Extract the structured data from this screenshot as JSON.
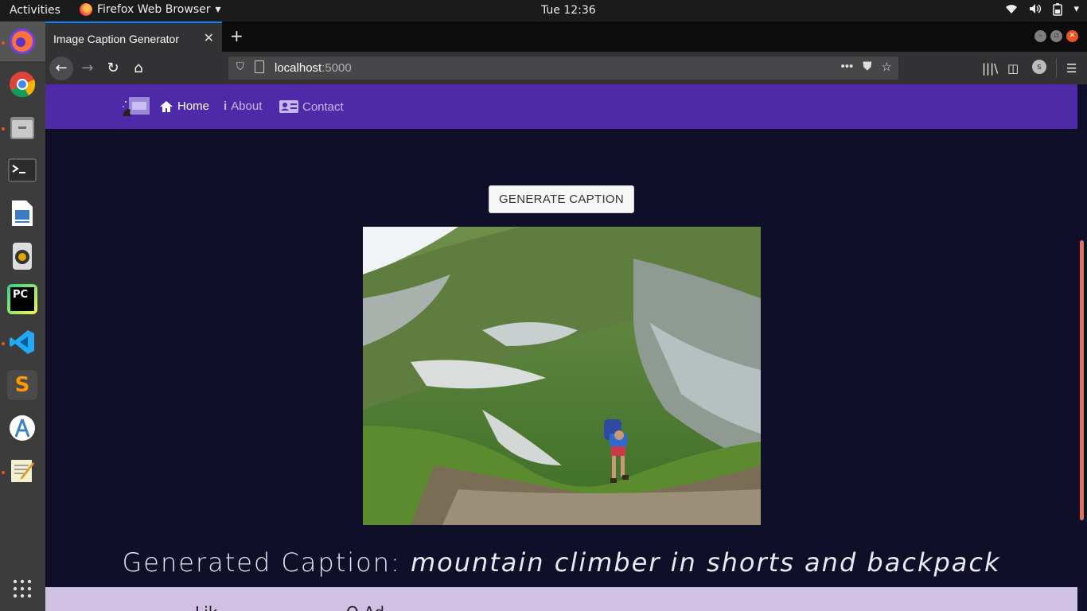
{
  "topbar": {
    "activities": "Activities",
    "app_menu": "Firefox Web Browser",
    "clock": "Tue 12:36",
    "tray_icons": [
      "wifi-icon",
      "volume-icon",
      "battery-icon",
      "system-menu-icon"
    ]
  },
  "dock": {
    "items": [
      {
        "name": "firefox",
        "icon": "firefox-icon",
        "running": true,
        "active": true
      },
      {
        "name": "chrome",
        "icon": "chrome-icon",
        "running": false
      },
      {
        "name": "files",
        "icon": "files-icon",
        "running": true
      },
      {
        "name": "terminal",
        "icon": "terminal-icon",
        "running": false
      },
      {
        "name": "libreoffice-writer",
        "icon": "writer-icon",
        "running": false
      },
      {
        "name": "rhythmbox",
        "icon": "music-icon",
        "running": false
      },
      {
        "name": "pycharm",
        "icon": "pycharm-icon",
        "label": "PC",
        "running": false
      },
      {
        "name": "vscode",
        "icon": "vscode-icon",
        "running": true
      },
      {
        "name": "sublime",
        "icon": "sublime-icon",
        "label": "S",
        "running": false
      },
      {
        "name": "android-studio",
        "icon": "android-studio-icon",
        "running": false
      },
      {
        "name": "text-editor",
        "icon": "text-editor-icon",
        "running": true
      }
    ],
    "show_apps_icon": "grid-icon"
  },
  "browser": {
    "tab_title": "Image Caption Generator",
    "url_host": "localhost",
    "url_port": ":5000"
  },
  "site": {
    "nav": {
      "home": "Home",
      "about": "About",
      "contact": "Contact"
    },
    "generate_button": "GENERATE CAPTION",
    "caption_label": "Generated Caption:",
    "caption_text": "mountain climber in shorts and backpack",
    "footer_fragment_1": "Lik",
    "footer_fragment_2": "O Ad"
  },
  "colors": {
    "nav_bg": "#4e2aa8",
    "page_bg": "#0f0f2a",
    "footer_bg": "#d0c1e4",
    "scroll_thumb": "#e2715a"
  }
}
